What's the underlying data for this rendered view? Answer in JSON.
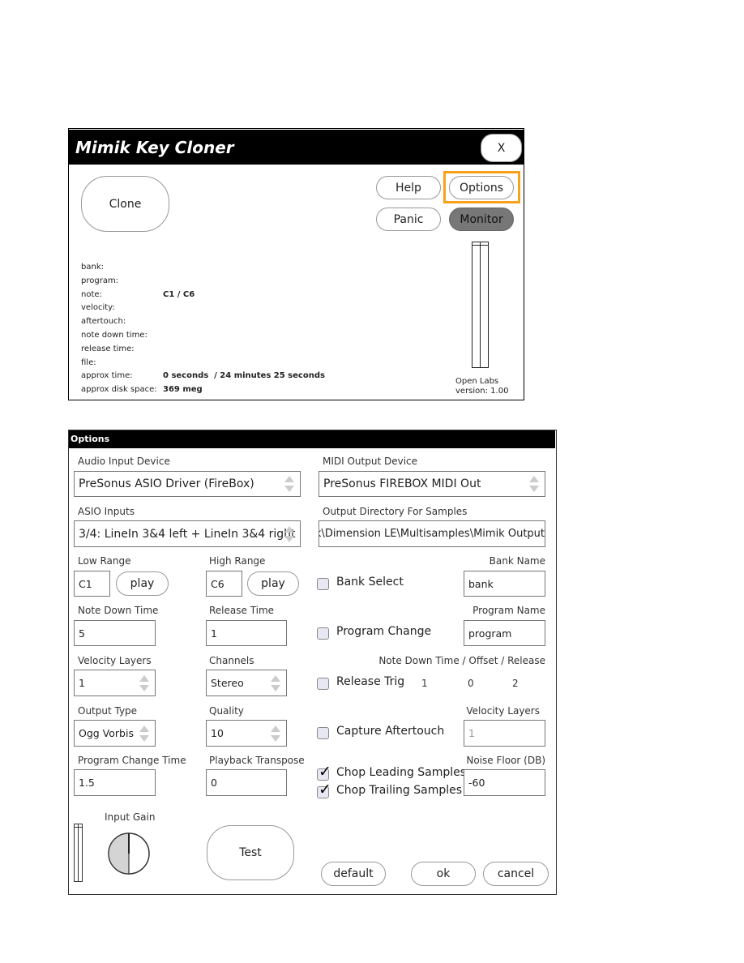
{
  "main_window": {
    "title": "Mimik Key Cloner",
    "close_label": "X",
    "clone_label": "Clone",
    "help_label": "Help",
    "options_label": "Options",
    "panic_label": "Panic",
    "monitor_label": "Monitor",
    "highlight_color": "#f7a21b",
    "info": [
      {
        "label": "bank:",
        "value": ""
      },
      {
        "label": "program:",
        "value": ""
      },
      {
        "label": "note:",
        "value": "C1 / C6"
      },
      {
        "label": "velocity:",
        "value": ""
      },
      {
        "label": "aftertouch:",
        "value": ""
      },
      {
        "label": "note down time:",
        "value": ""
      },
      {
        "label": "release time:",
        "value": ""
      },
      {
        "label": "file:",
        "value": ""
      },
      {
        "label": "approx time:",
        "value": "0 seconds  / 24 minutes 25 seconds"
      },
      {
        "label": "approx disk space:",
        "value": "369 meg"
      }
    ],
    "company": "Open Labs",
    "version": "version: 1.00"
  },
  "options": {
    "title": "Options",
    "audio_input_device": {
      "label": "Audio Input Device",
      "value": "PreSonus ASIO Driver (FireBox)"
    },
    "midi_output_device": {
      "label": "MIDI Output Device",
      "value": "PreSonus FIREBOX MIDI Out"
    },
    "asio_inputs": {
      "label": "ASIO Inputs",
      "value": "3/4: LineIn 3&4 left + LineIn 3&4 right"
    },
    "output_directory": {
      "label": "Output Directory For Samples",
      "value": "alk\\Dimension LE\\Multisamples\\Mimik Output"
    },
    "low_range": {
      "label": "Low Range",
      "value": "C1",
      "play_label": "play"
    },
    "high_range": {
      "label": "High Range",
      "value": "C6",
      "play_label": "play"
    },
    "bank_select": {
      "label": "Bank Select",
      "checked": false
    },
    "bank_name": {
      "label": "Bank Name",
      "value": "bank"
    },
    "note_down_time": {
      "label": "Note Down Time",
      "value": "5"
    },
    "release_time": {
      "label": "Release Time",
      "value": "1"
    },
    "program_change": {
      "label": "Program Change",
      "checked": false
    },
    "program_name": {
      "label": "Program Name",
      "value": "program"
    },
    "velocity_layers": {
      "label": "Velocity Layers",
      "value": "1"
    },
    "channels": {
      "label": "Channels",
      "value": "Stereo"
    },
    "release_trig": {
      "label": "Release Trig",
      "checked": false,
      "header": "Note Down Time / Offset / Release",
      "note_down": "1",
      "offset": "0",
      "release": "2"
    },
    "output_type": {
      "label": "Output Type",
      "value": "Ogg Vorbis"
    },
    "quality": {
      "label": "Quality",
      "value": "10"
    },
    "capture_aftertouch": {
      "label": "Capture Aftertouch",
      "checked": false
    },
    "aftertouch_velocity_layers": {
      "label": "Velocity Layers",
      "value": "1"
    },
    "program_change_time": {
      "label": "Program Change Time",
      "value": "1.5"
    },
    "playback_transpose": {
      "label": "Playback Transpose",
      "value": "0"
    },
    "chop_leading": {
      "label": "Chop Leading Samples",
      "checked": true
    },
    "chop_trailing": {
      "label": "Chop Trailing Samples",
      "checked": true
    },
    "noise_floor": {
      "label": "Noise Floor (DB)",
      "value": "-60"
    },
    "input_gain": {
      "label": "Input Gain",
      "level": 0.5
    },
    "test_label": "Test",
    "default_label": "default",
    "ok_label": "ok",
    "cancel_label": "cancel"
  }
}
